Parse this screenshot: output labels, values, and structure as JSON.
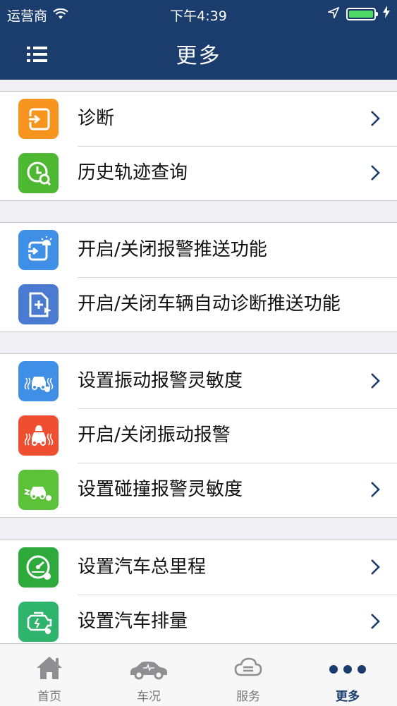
{
  "status_bar": {
    "carrier": "运营商",
    "time": "下午4:39"
  },
  "header": {
    "title": "更多"
  },
  "groups": [
    {
      "items": [
        {
          "label": "诊断",
          "icon": "diagnose-icon",
          "color": "#f7941d"
        },
        {
          "label": "历史轨迹查询",
          "icon": "history-track-icon",
          "color": "#4fb833"
        }
      ]
    },
    {
      "items": [
        {
          "label": "开启/关闭报警推送功能",
          "icon": "alarm-push-icon",
          "color": "#3f8fe6"
        },
        {
          "label": "开启/关闭车辆自动诊断推送功能",
          "icon": "auto-diagnose-push-icon",
          "color": "#4a7bd0"
        }
      ]
    },
    {
      "items": [
        {
          "label": "设置振动报警灵敏度",
          "icon": "vibration-sensitivity-icon",
          "color": "#3f8fe6"
        },
        {
          "label": "开启/关闭振动报警",
          "icon": "vibration-alarm-icon",
          "color": "#f04e30"
        },
        {
          "label": "设置碰撞报警灵敏度",
          "icon": "collision-sensitivity-icon",
          "color": "#5cc23a"
        }
      ]
    },
    {
      "items": [
        {
          "label": "设置汽车总里程",
          "icon": "mileage-icon",
          "color": "#2eaa3c"
        },
        {
          "label": "设置汽车排量",
          "icon": "engine-displacement-icon",
          "color": "#2fb46e"
        }
      ]
    }
  ],
  "tabbar": {
    "tabs": [
      {
        "label": "首页",
        "icon": "home-icon"
      },
      {
        "label": "车况",
        "icon": "car-status-icon"
      },
      {
        "label": "服务",
        "icon": "service-icon"
      },
      {
        "label": "更多",
        "icon": "more-icon"
      }
    ],
    "active_color": "#1a3d6e",
    "inactive_color": "#8e8e93"
  }
}
